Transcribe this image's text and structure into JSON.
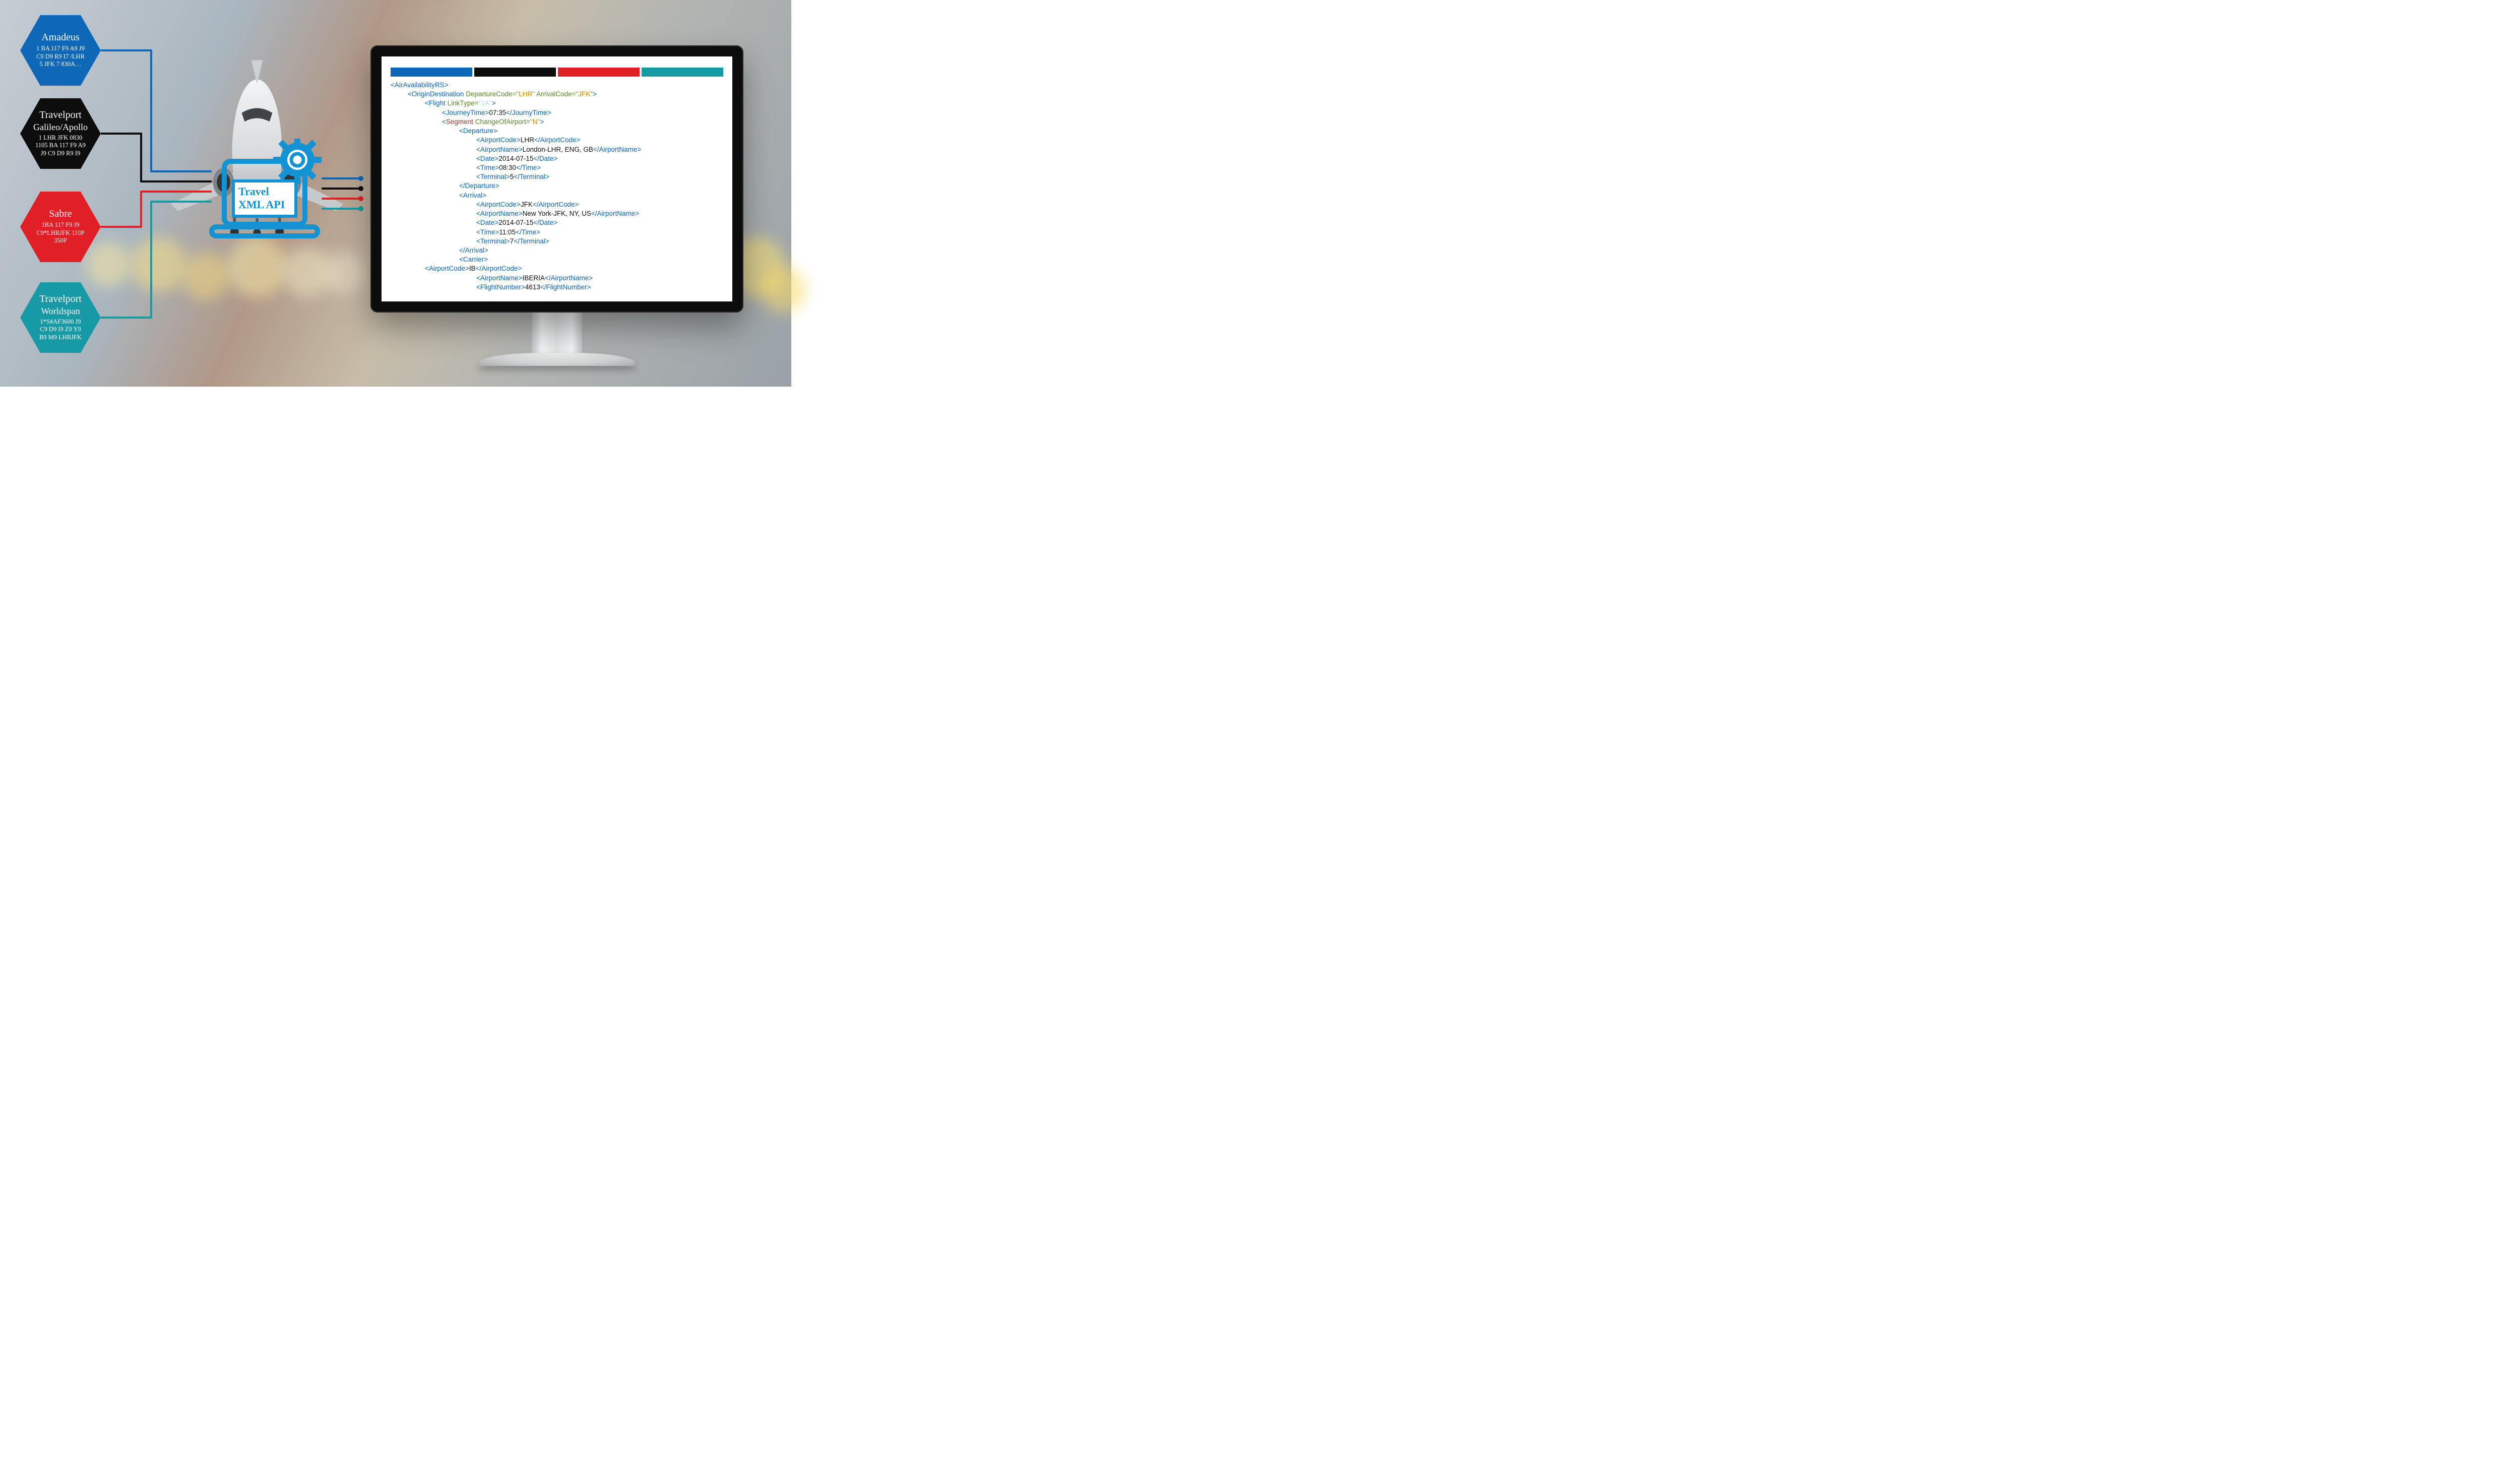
{
  "colors": {
    "amadeus": "#0e67b7",
    "travelport": "#0d0d0d",
    "sabre": "#e01f26",
    "worldspan": "#169aa6"
  },
  "hexes": [
    {
      "id": "amadeus",
      "title": "Amadeus",
      "subtitle": "",
      "body": "1 BA 117 F9 A9 J9\nC9 D9 R9 I7 /LHR\n5 JFK 7 830A…"
    },
    {
      "id": "travelport",
      "title": "Travelport",
      "subtitle": "Galileo/Apollo",
      "body": "1 LHR JFK 0830\n1105 BA 117 F9 A9\nJ9 C9 D9 R9 I9"
    },
    {
      "id": "sabre",
      "title": "Sabre",
      "subtitle": "",
      "body": "1BA     117 F9 J9\nC9*LHRJFK 110P\n350P"
    },
    {
      "id": "worldspan",
      "title": "Travelport",
      "subtitle": "Worldspan",
      "body": "1*S#AF3600 J9\nC9 D9 I9 Z9 Y9\nB9 M9 LHRJFK"
    }
  ],
  "api_label_line1": "Travel",
  "api_label_line2": "XML API",
  "xml": {
    "root": "AirAvailabilityRS",
    "origin": {
      "tag": "OriginDestination",
      "dep_attr": "DepartureCode",
      "dep_val": "LHR",
      "arr_attr": "ArrivalCode",
      "arr_val": "JFK"
    },
    "flight": {
      "tag": "Flight",
      "attr": "LinkType",
      "val": "1A"
    },
    "journey": {
      "tag": "JourneyTime",
      "close": "JournyTime",
      "val": "07:35"
    },
    "segment": {
      "tag": "Segment",
      "attr": "ChangeOfAirport",
      "val": "N"
    },
    "departure": {
      "tag": "Departure",
      "airportCode": "LHR",
      "airportName": "London-LHR, ENG, GB",
      "date": "2014-07-15",
      "time": "08:30",
      "terminal": "5"
    },
    "arrival": {
      "tag": "Arrival",
      "airportCode": "JFK",
      "airportName": "New York-JFK, NY, US",
      "date": "2014-07-15",
      "time": "11:05",
      "terminal": "7"
    },
    "labels": {
      "airportCode": "AirportCode",
      "airportName": "AirportName",
      "date": "Date",
      "time": "Time",
      "terminal": "Terminal",
      "carrier": "Carrier",
      "flightNumber": "FlightNumber"
    },
    "carrier": {
      "airportCode": "IB",
      "airportName": "IBERIA",
      "flightNumber": "4613"
    }
  }
}
